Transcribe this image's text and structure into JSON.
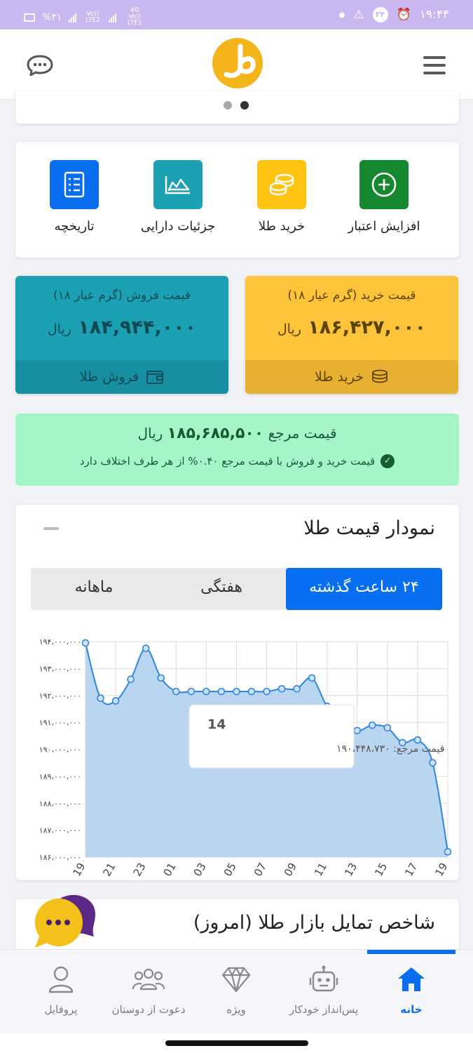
{
  "status_bar": {
    "time": "۱۹:۴۴",
    "badge": "۲۴",
    "battery": "%۳۱",
    "net1": "Vo)) LTE2",
    "net2": "4G Vo)) LTE1"
  },
  "header": {
    "menu_icon": "hamburger-icon",
    "logo_icon": "brand-logo",
    "chat_icon": "chat-bubble-icon"
  },
  "carousel": {
    "dots": 2,
    "active_dot": 1
  },
  "actions": [
    {
      "label": "افزایش اعتبار",
      "icon": "plus-circle-icon",
      "color": "#16882f"
    },
    {
      "label": "خرید طلا",
      "icon": "coins-icon",
      "color": "#ffc312"
    },
    {
      "label": "جزئیات دارایی",
      "icon": "area-chart-icon",
      "color": "#1ba1b3"
    },
    {
      "label": "تاریخچه",
      "icon": "list-icon",
      "color": "#0a6ef0"
    }
  ],
  "buy_card": {
    "title": "قیمت خرید (گرم عیار ۱۸)",
    "value": "۱۸۶,۴۲۷,۰۰۰",
    "unit": "ریال",
    "action": "خرید طلا",
    "bg": "#fdc33a",
    "foot_bg": "#e8b030"
  },
  "sell_card": {
    "title": "قیمت فروش (گرم عیار ۱۸)",
    "value": "۱۸۴,۹۴۴,۰۰۰",
    "unit": "ریال",
    "action": "فروش طلا",
    "bg": "#1ba1b3",
    "foot_bg": "#188fa0"
  },
  "reference": {
    "label": "قیمت مرجع",
    "value": "۱۸۵,۶۸۵,۵۰۰",
    "unit": "ریال",
    "note": "قیمت خرید و فروش با قیمت مرجع ۰.۴۰% از هر طرف اختلاف دارد"
  },
  "chart_section": {
    "title": "نمودار قیمت طلا",
    "tabs": [
      "۲۴ ساعت گذشته",
      "هفتگی",
      "ماهانه"
    ],
    "active_tab": 0
  },
  "chart_data": {
    "type": "area",
    "x_ticks": [
      "19",
      "21",
      "23",
      "01",
      "03",
      "05",
      "07",
      "09",
      "11",
      "13",
      "15",
      "17",
      "19"
    ],
    "y_ticks": [
      "۱۸۶،۰۰۰،۰۰۰",
      "۱۸۷،۰۰۰،۰۰۰",
      "۱۸۸،۰۰۰،۰۰۰",
      "۱۸۹،۰۰۰،۰۰۰",
      "۱۹۰،۰۰۰،۰۰۰",
      "۱۹۱،۰۰۰،۰۰۰",
      "۱۹۲،۰۰۰،۰۰۰",
      "۱۹۳،۰۰۰،۰۰۰",
      "۱۹۴،۰۰۰،۰۰۰"
    ],
    "ylim": [
      186000000,
      194000000
    ],
    "x": [
      0,
      1,
      2,
      3,
      4,
      5,
      6,
      7,
      8,
      9,
      10,
      11,
      12,
      13,
      14,
      15,
      16,
      17,
      18,
      19,
      20,
      21,
      22,
      23,
      24
    ],
    "values": [
      193950000,
      191900000,
      191800000,
      192600000,
      193750000,
      192650000,
      192150000,
      192150000,
      192150000,
      192150000,
      192150000,
      192150000,
      192150000,
      192250000,
      192250000,
      192650000,
      191600000,
      191100000,
      190700000,
      190900000,
      190800000,
      190250000,
      190350000,
      189500000,
      186200000
    ],
    "color": "#2e86de",
    "fill": "#b9d5ef",
    "grid": true,
    "tooltip": {
      "title": "14",
      "label": "قیمت مرجع:",
      "value": "۱۹۰،۴۴۸،۷۳۰"
    }
  },
  "market_section": {
    "title": "شاخص تمایل بازار طلا (امروز)"
  },
  "fab": {
    "icon": "chat-dots-icon"
  },
  "bottom_nav": [
    {
      "label": "خانه",
      "icon": "home-icon",
      "active": true
    },
    {
      "label": "پس‌انداز خودکار",
      "icon": "robot-icon",
      "active": false
    },
    {
      "label": "ویژه",
      "icon": "diamond-icon",
      "active": false
    },
    {
      "label": "دعوت از دوستان",
      "icon": "users-icon",
      "active": false
    },
    {
      "label": "پروفایل",
      "icon": "user-icon",
      "active": false
    }
  ]
}
